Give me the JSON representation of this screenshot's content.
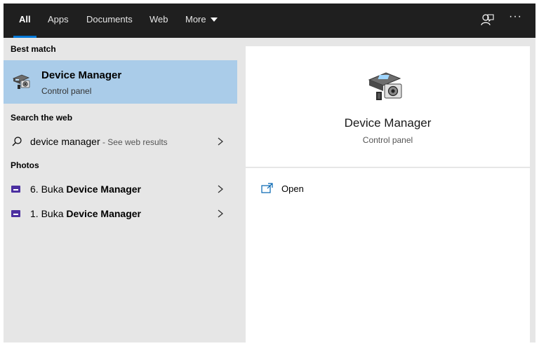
{
  "tabs": [
    {
      "label": "All",
      "active": true
    },
    {
      "label": "Apps"
    },
    {
      "label": "Documents"
    },
    {
      "label": "Web"
    },
    {
      "label": "More"
    }
  ],
  "topbar_icons": [
    "feedback-icon",
    "more-options-icon"
  ],
  "more_options_glyph": "···",
  "sections": {
    "best_match": "Best match",
    "search_web": "Search the web",
    "photos": "Photos"
  },
  "best_match": {
    "title": "Device Manager",
    "subtitle": "Control panel"
  },
  "web_result": {
    "query": "device manager",
    "hint": " - See web results"
  },
  "photos": [
    {
      "prefix": "6. Buka ",
      "bold": "Device Manager"
    },
    {
      "prefix": "1. Buka ",
      "bold": "Device Manager"
    }
  ],
  "preview": {
    "title": "Device Manager",
    "subtitle": "Control panel",
    "open_label": "Open"
  },
  "colors": {
    "topbar": "#1f1f1f",
    "accent": "#0078d7",
    "selection": "#aacce9",
    "photo_icon": "#4b2fa0"
  }
}
